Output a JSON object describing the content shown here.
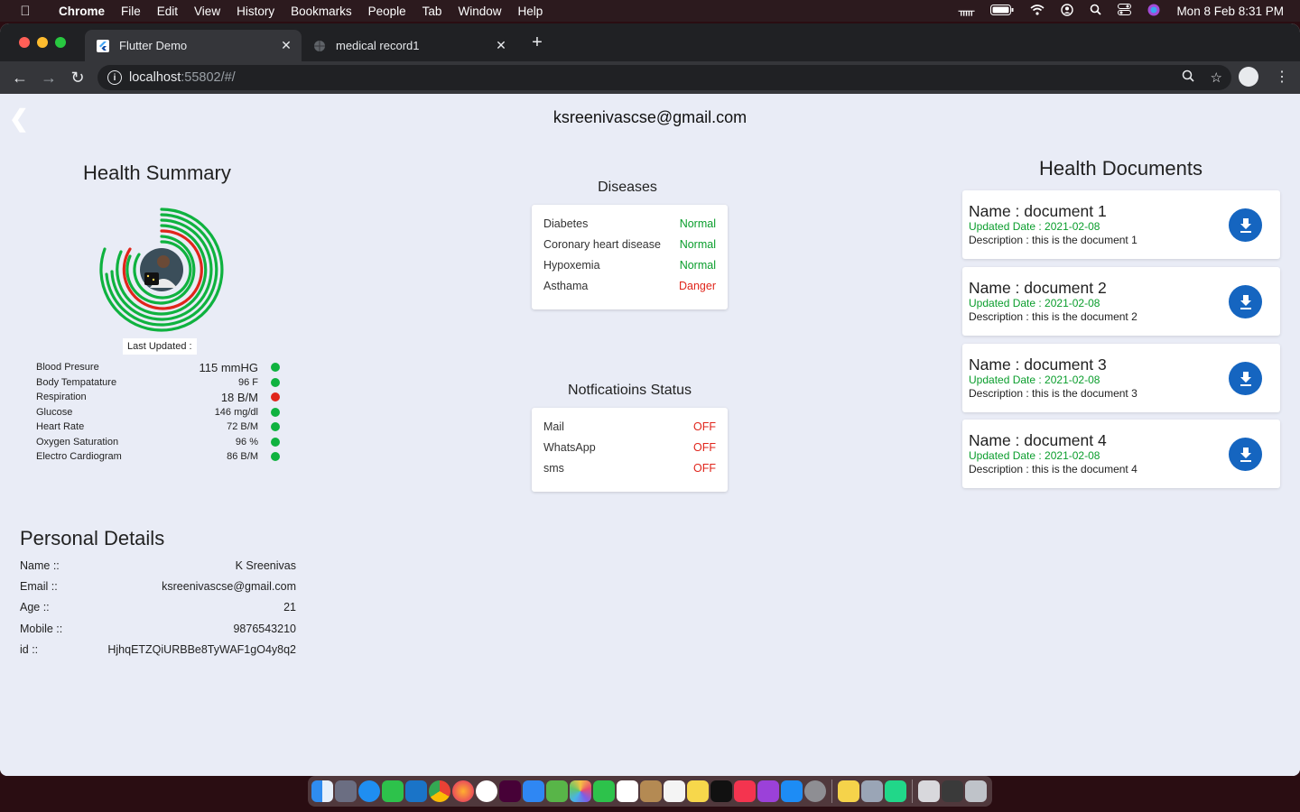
{
  "menubar": {
    "app": "Chrome",
    "items": [
      "File",
      "Edit",
      "View",
      "History",
      "Bookmarks",
      "People",
      "Tab",
      "Window",
      "Help"
    ],
    "clock": "Mon 8 Feb  8:31 PM"
  },
  "browser": {
    "tabs": [
      {
        "title": "Flutter Demo",
        "active": true
      },
      {
        "title": "medical record1",
        "active": false
      }
    ],
    "url_host": "localhost",
    "url_path": ":55802/#/"
  },
  "page": {
    "user_email": "ksreenivascse@gmail.com",
    "health_summary": {
      "title": "Health Summary",
      "last_updated_label": "Last Updated :",
      "vitals": [
        {
          "label": "Blood Presure",
          "value": "115 mmHG",
          "status": "ok"
        },
        {
          "label": "Body Tempatature",
          "value": "96 F",
          "status": "ok"
        },
        {
          "label": "Respiration",
          "value": "18 B/M",
          "status": "danger"
        },
        {
          "label": "Glucose",
          "value": "146 mg/dl",
          "status": "ok"
        },
        {
          "label": "Heart Rate",
          "value": "72 B/M",
          "status": "ok"
        },
        {
          "label": "Oxygen Saturation",
          "value": "96 %",
          "status": "ok"
        },
        {
          "label": "Electro Cardiogram",
          "value": "86 B/M",
          "status": "ok"
        }
      ]
    },
    "personal_details": {
      "title": "Personal Details",
      "rows": [
        {
          "label": "Name ::",
          "value": "K Sreenivas"
        },
        {
          "label": "Email ::",
          "value": "ksreenivascse@gmail.com"
        },
        {
          "label": "Age ::",
          "value": "21"
        },
        {
          "label": "Mobile ::",
          "value": "9876543210"
        },
        {
          "label": "id ::",
          "value": "HjhqETZQiURBBe8TyWAF1gO4y8q2"
        }
      ]
    },
    "diseases": {
      "title": "Diseases",
      "rows": [
        {
          "name": "Diabetes",
          "status": "Normal"
        },
        {
          "name": "Coronary heart disease",
          "status": "Normal"
        },
        {
          "name": "Hypoxemia",
          "status": "Normal"
        },
        {
          "name": "Asthama",
          "status": "Danger"
        }
      ]
    },
    "notifications": {
      "title": "Notficatioins Status",
      "rows": [
        {
          "name": "Mail",
          "status": "OFF"
        },
        {
          "name": "WhatsApp",
          "status": "OFF"
        },
        {
          "name": "sms",
          "status": "OFF"
        }
      ]
    },
    "health_documents": {
      "title": "Health Documents",
      "docs": [
        {
          "name": "Name : document 1",
          "date": "Updated Date : 2021-02-08",
          "desc": "Description : this is the document 1"
        },
        {
          "name": "Name : document 2",
          "date": "Updated Date : 2021-02-08",
          "desc": "Description : this is the document 2"
        },
        {
          "name": "Name : document 3",
          "date": "Updated Date : 2021-02-08",
          "desc": "Description : this is the document 3"
        },
        {
          "name": "Name : document 4",
          "date": "Updated Date : 2021-02-08",
          "desc": "Description : this is the document 4"
        }
      ]
    }
  },
  "colors": {
    "ok": "#0a9d2c",
    "danger": "#e0251b",
    "accent": "#1565c0"
  }
}
